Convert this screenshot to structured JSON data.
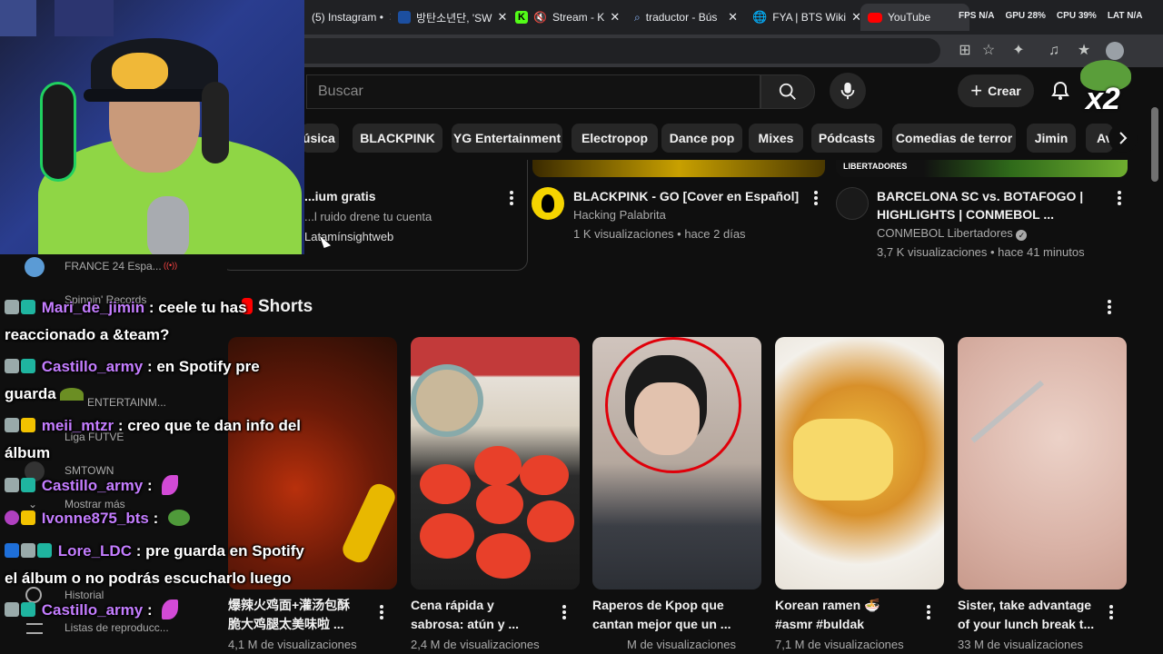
{
  "browser": {
    "tabs": [
      {
        "label": "(5) Instagram •",
        "icon": "instagram-icon",
        "color": "#e4405f"
      },
      {
        "label": "방탄소년단, 'SW",
        "icon": "bs-icon",
        "color": "#1c4fa0"
      },
      {
        "label": "Stream - K",
        "icon": "kick-icon",
        "color": "#53fc18"
      },
      {
        "label": "traductor - Bús",
        "icon": "search-icon",
        "color": "#8ab4f8"
      },
      {
        "label": "FYA | BTS Wiki",
        "icon": "globe-icon",
        "color": "#e8eaed"
      },
      {
        "label": "YouTube",
        "icon": "youtube-icon",
        "color": "#ff0000"
      }
    ],
    "perf": [
      "FPS N/A",
      "GPU 28%",
      "CPU 39%",
      "LAT N/A"
    ]
  },
  "youtube": {
    "search_placeholder": "Buscar",
    "create_label": "Crear",
    "chips": [
      "Música",
      "BLACKPINK",
      "YG Entertainment",
      "Electropop",
      "Dance pop",
      "Mixes",
      "Pódcasts",
      "Comedias de terror",
      "Jimin",
      "Av"
    ],
    "videos": [
      {
        "title": "...ium gratis",
        "line2": "...l ruido drene tu cuenta",
        "line3": "Latamínsightweb"
      },
      {
        "title": "BLACKPINK - GO [Cover en Español]",
        "channel": "Hacking Palabrita",
        "meta": "1 K visualizaciones • hace 2 días"
      },
      {
        "title_line1": "BARCELONA SC vs. BOTAFOGO |",
        "title_line2": "HIGHLIGHTS | CONMEBOL ...",
        "channel": "CONMEBOL Libertadores",
        "meta": "3,7 K visualizaciones • hace 41 minutos",
        "thumb_label": "LIBERTADORES"
      }
    ],
    "shorts_heading": "Shorts",
    "shorts": [
      {
        "line1": "爆辣火鸡面+灌汤包酥",
        "line2": "脆大鸡腿太美味啦 ...",
        "views": "4,1 M de visualizaciones"
      },
      {
        "line1": "Cena rápida y",
        "line2": "sabrosa: atún y ...",
        "views": "2,4 M de visualizaciones"
      },
      {
        "line1": "Raperos de Kpop que",
        "line2": "cantan mejor que un ...",
        "views": "M de visualizaciones"
      },
      {
        "line1": "Korean ramen 🍜",
        "line2": "#asmr #buldak",
        "views": "7,1 M de visualizaciones"
      },
      {
        "line1": "Sister, take advantage",
        "line2": "of your lunch break t...",
        "views": "33 M de visualizaciones"
      }
    ]
  },
  "sidebar": {
    "items": [
      "FRANCE 24 Espa...",
      "Spinnin' Records",
      "ENTERTAINM...",
      "Liga FUTVE",
      "SMTOWN",
      "Mostrar más",
      "Historial",
      "Listas de reproducc..."
    ]
  },
  "overlay": {
    "multiplier": "x2"
  },
  "chat": [
    {
      "user": "Mari_de_jimin",
      "text": ": ceele tu has",
      "cont": "reaccionado a &team?"
    },
    {
      "user": "Castillo_army",
      "text": ": en Spotify pre",
      "cont": "guarda"
    },
    {
      "user": "meii_mtzr",
      "text": ": creo que te dan info del",
      "cont": "álbum"
    },
    {
      "user": "Castillo_army",
      "text": ":"
    },
    {
      "user": "Ivonne875_bts",
      "text": ":"
    },
    {
      "user": "Lore_LDC",
      "text": ": pre guarda en Spotify",
      "cont": "el álbum o no podrás escucharlo luego"
    },
    {
      "user": "Castillo_army",
      "text": ":"
    }
  ]
}
